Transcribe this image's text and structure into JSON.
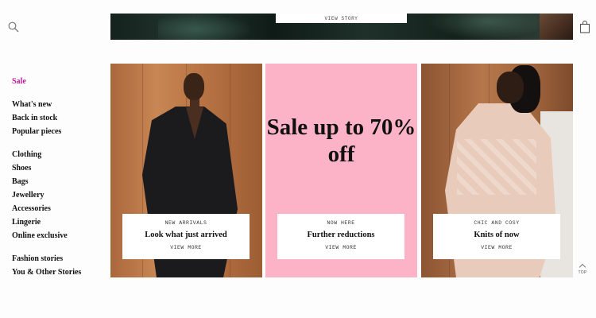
{
  "header": {
    "search_icon": "search-icon",
    "bag_icon": "shopping-bag-icon"
  },
  "hero": {
    "cta": "VIEW STORY"
  },
  "sidebar": {
    "sale": "Sale",
    "group1": [
      "What's new",
      "Back in stock",
      "Popular pieces"
    ],
    "group2": [
      "Clothing",
      "Shoes",
      "Bags",
      "Jewellery",
      "Accessories",
      "Lingerie",
      "Online exclusive"
    ],
    "group3": [
      "Fashion stories",
      "You & Other Stories"
    ]
  },
  "promos": [
    {
      "kicker": "NEW ARRIVALS",
      "heading": "Look what just arrived",
      "cta": "VIEW MORE"
    },
    {
      "big_text": "Sale up to 70% off",
      "kicker": "NOW HERE",
      "heading": "Further reductions",
      "cta": "VIEW MORE"
    },
    {
      "kicker": "CHIC AND COSY",
      "heading": "Knits of now",
      "cta": "VIEW MORE"
    }
  ],
  "back_to_top": "TOP",
  "colors": {
    "sale_accent": "#c2189f",
    "sale_panel": "#fdb3c7"
  }
}
